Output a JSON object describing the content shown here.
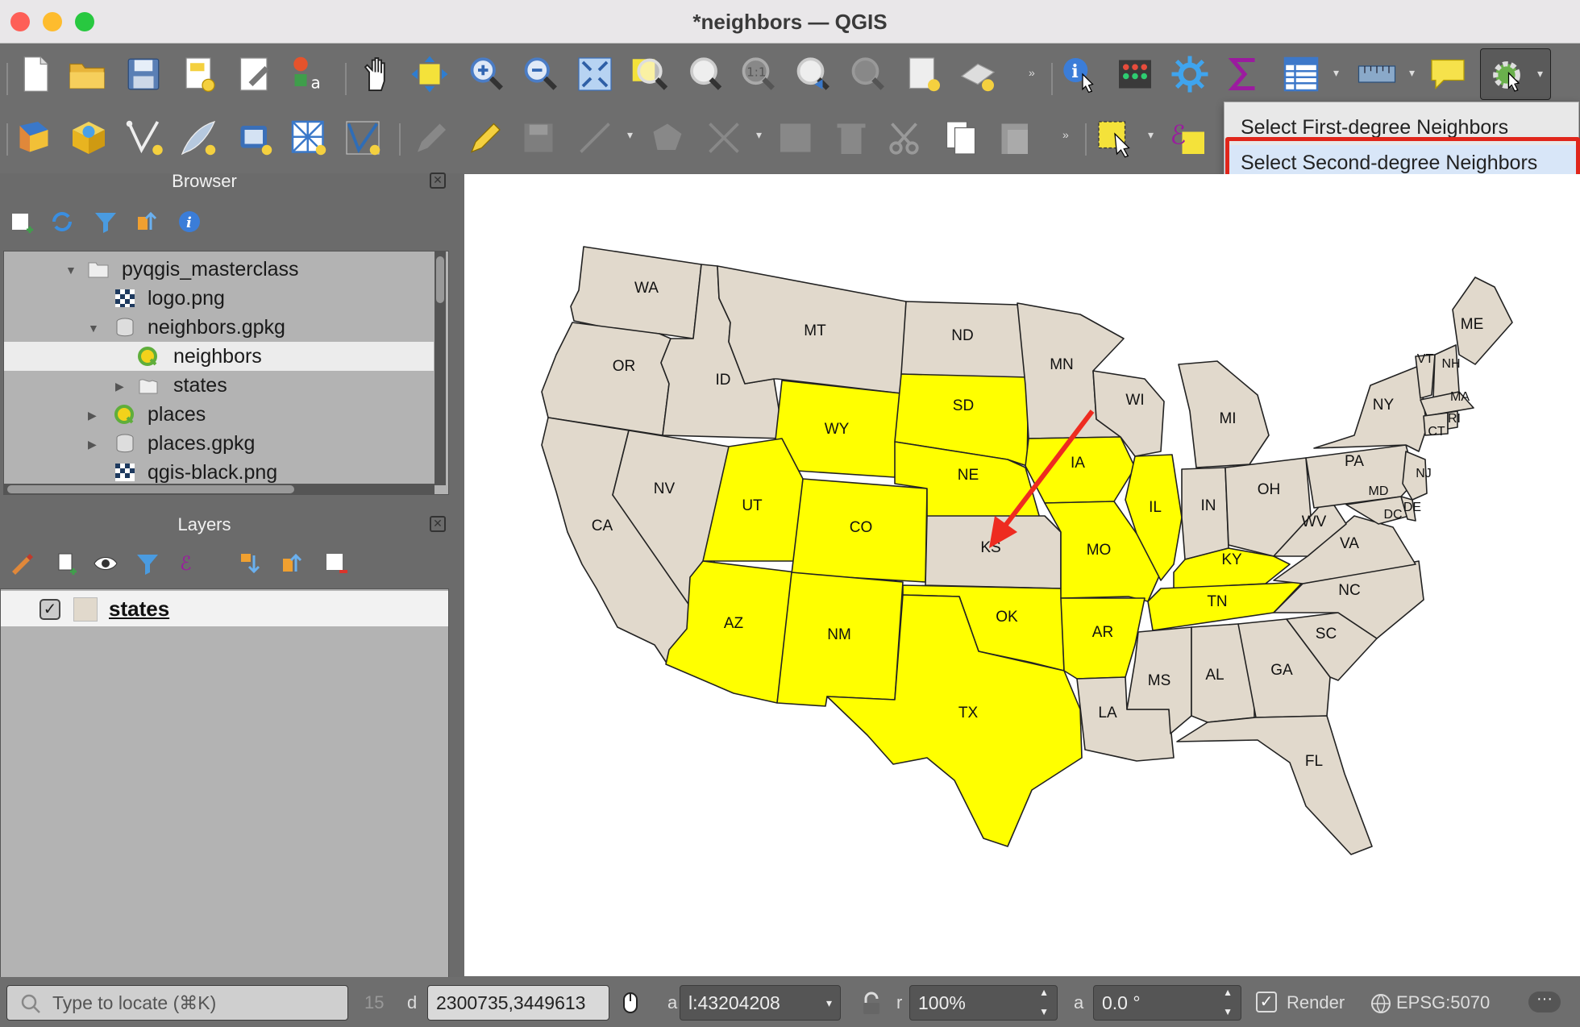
{
  "window": {
    "title": "*neighbors — QGIS"
  },
  "menu": {
    "item1": "Select First-degree Neighbors",
    "item2": "Select Second-degree Neighbors"
  },
  "browser": {
    "title": "Browser",
    "items": [
      "pyqgis_masterclass",
      "logo.png",
      "neighbors.gpkg",
      "neighbors",
      "states",
      "places",
      "places.gpkg",
      "qgis-black.png"
    ]
  },
  "layers": {
    "title": "Layers",
    "layer": "states"
  },
  "map": {
    "states": [
      "WA",
      "OR",
      "CA",
      "ID",
      "NV",
      "MT",
      "WY",
      "UT",
      "AZ",
      "CO",
      "NM",
      "ND",
      "SD",
      "NE",
      "KS",
      "OK",
      "TX",
      "MN",
      "IA",
      "MO",
      "AR",
      "LA",
      "WI",
      "IL",
      "MI",
      "IN",
      "OH",
      "KY",
      "TN",
      "MS",
      "AL",
      "GA",
      "FL",
      "SC",
      "NC",
      "VA",
      "WV",
      "PA",
      "NY",
      "ME",
      "VT",
      "NH",
      "MA",
      "CT",
      "RI",
      "NJ",
      "MD",
      "DE",
      "DC"
    ],
    "selected": [
      "SD",
      "WY",
      "NE",
      "IA",
      "UT",
      "CO",
      "MO",
      "IL",
      "KY",
      "AZ",
      "NM",
      "OK",
      "AR",
      "TN",
      "TX"
    ],
    "colors": {
      "selected": "#ffff00",
      "unselected": "#e1d9cc"
    }
  },
  "status": {
    "locate_placeholder": "Type to locate (⌘K)",
    "coord_label": "d",
    "coordinate": "2300735,3449613",
    "scale_label": "a",
    "scale": "l:43204208",
    "mag_label": "r",
    "magnifier": "100%",
    "rot_label": "a",
    "rotation": "0.0 °",
    "render": "Render",
    "crs": "EPSG:5070",
    "num": "15"
  }
}
